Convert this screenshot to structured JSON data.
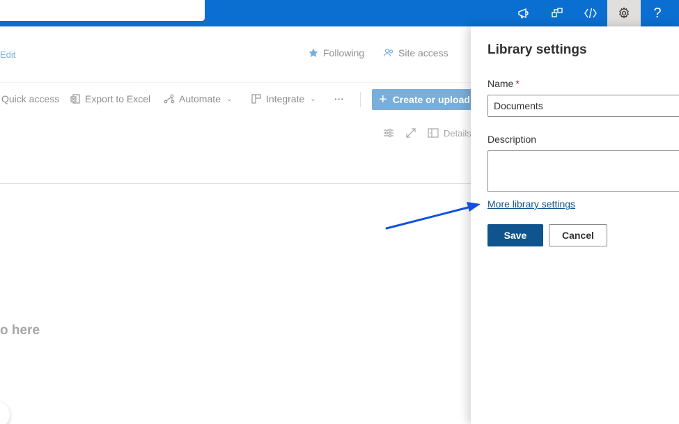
{
  "suitebar": {
    "icons": [
      "announcement-icon",
      "app-launcher-icon",
      "code-icon",
      "gear-icon",
      "help-icon"
    ],
    "help_glyph": "?"
  },
  "header": {
    "edit_label": "Edit",
    "following_label": "Following",
    "site_access_label": "Site access"
  },
  "commandbar": {
    "quick_access_label": "Quick access",
    "export_label": "Export to Excel",
    "automate_label": "Automate",
    "integrate_label": "Integrate",
    "more_label": "···",
    "create_label": "Create or upload"
  },
  "view": {
    "details_label": "Details"
  },
  "empty_state": {
    "text": "o here"
  },
  "panel": {
    "title": "Library settings",
    "name_label": "Name",
    "required_mark": "*",
    "name_value": "Documents",
    "description_label": "Description",
    "description_value": "",
    "more_settings_link": "More library settings",
    "save_label": "Save",
    "cancel_label": "Cancel"
  },
  "colors": {
    "suitebar": "#0a6fd1",
    "primary": "#0f548c",
    "annotation_arrow": "#1150e0"
  }
}
